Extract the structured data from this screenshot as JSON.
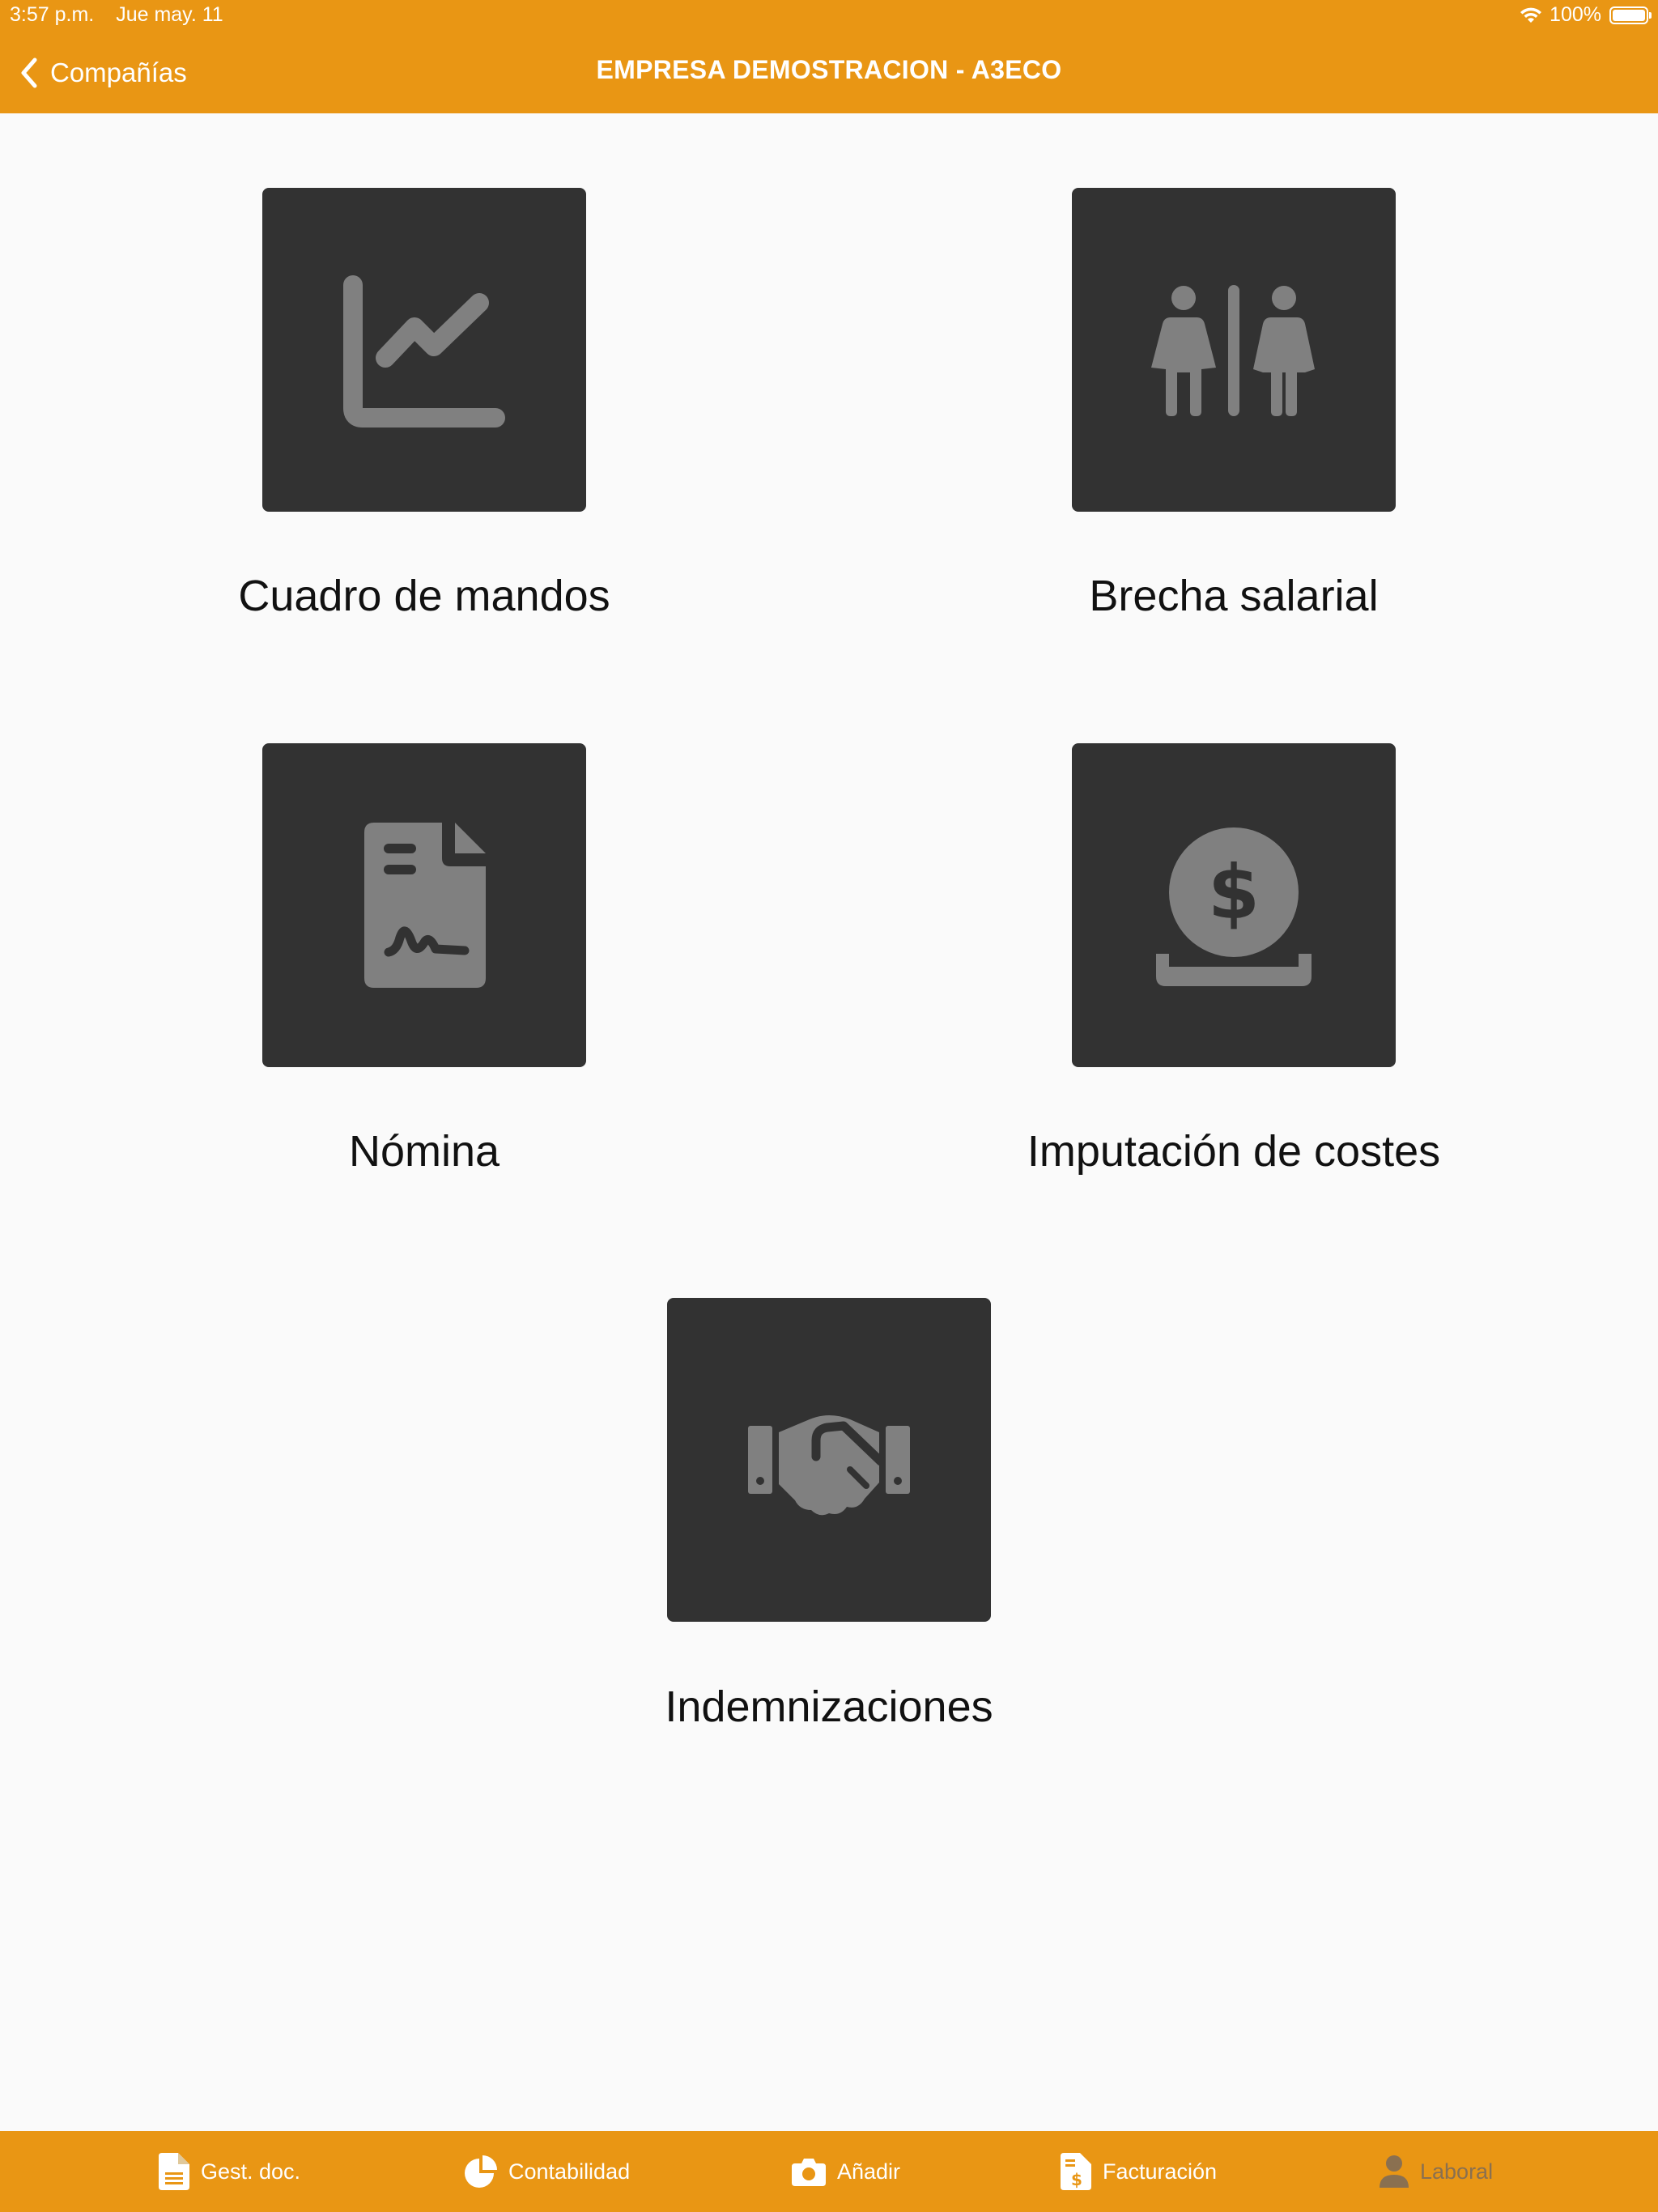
{
  "status_bar": {
    "time": "3:57 p.m.",
    "date": "Jue may. 11",
    "battery": "100%"
  },
  "nav": {
    "back_label": "Compañías",
    "title": "EMPRESA DEMOSTRACION - A3ECO"
  },
  "tiles": [
    {
      "label": "Cuadro de mandos",
      "icon": "line-chart-icon"
    },
    {
      "label": "Brecha salarial",
      "icon": "restroom-icon"
    },
    {
      "label": "Nómina",
      "icon": "signed-document-icon"
    },
    {
      "label": "Imputación de costes",
      "icon": "coin-dollar-icon"
    },
    {
      "label": "Indemnizaciones",
      "icon": "handshake-icon"
    }
  ],
  "tab_bar": {
    "items": [
      {
        "label": "Gest. doc.",
        "icon": "document-icon",
        "active": false
      },
      {
        "label": "Contabilidad",
        "icon": "pie-chart-icon",
        "active": false
      },
      {
        "label": "Añadir",
        "icon": "camera-icon",
        "active": false
      },
      {
        "label": "Facturación",
        "icon": "invoice-icon",
        "active": false
      },
      {
        "label": "Laboral",
        "icon": "person-icon",
        "active": true
      }
    ]
  },
  "colors": {
    "brand_orange": "#e99614",
    "tile_background": "#323232",
    "icon_gray": "#808080",
    "page_background": "#fafafa"
  }
}
